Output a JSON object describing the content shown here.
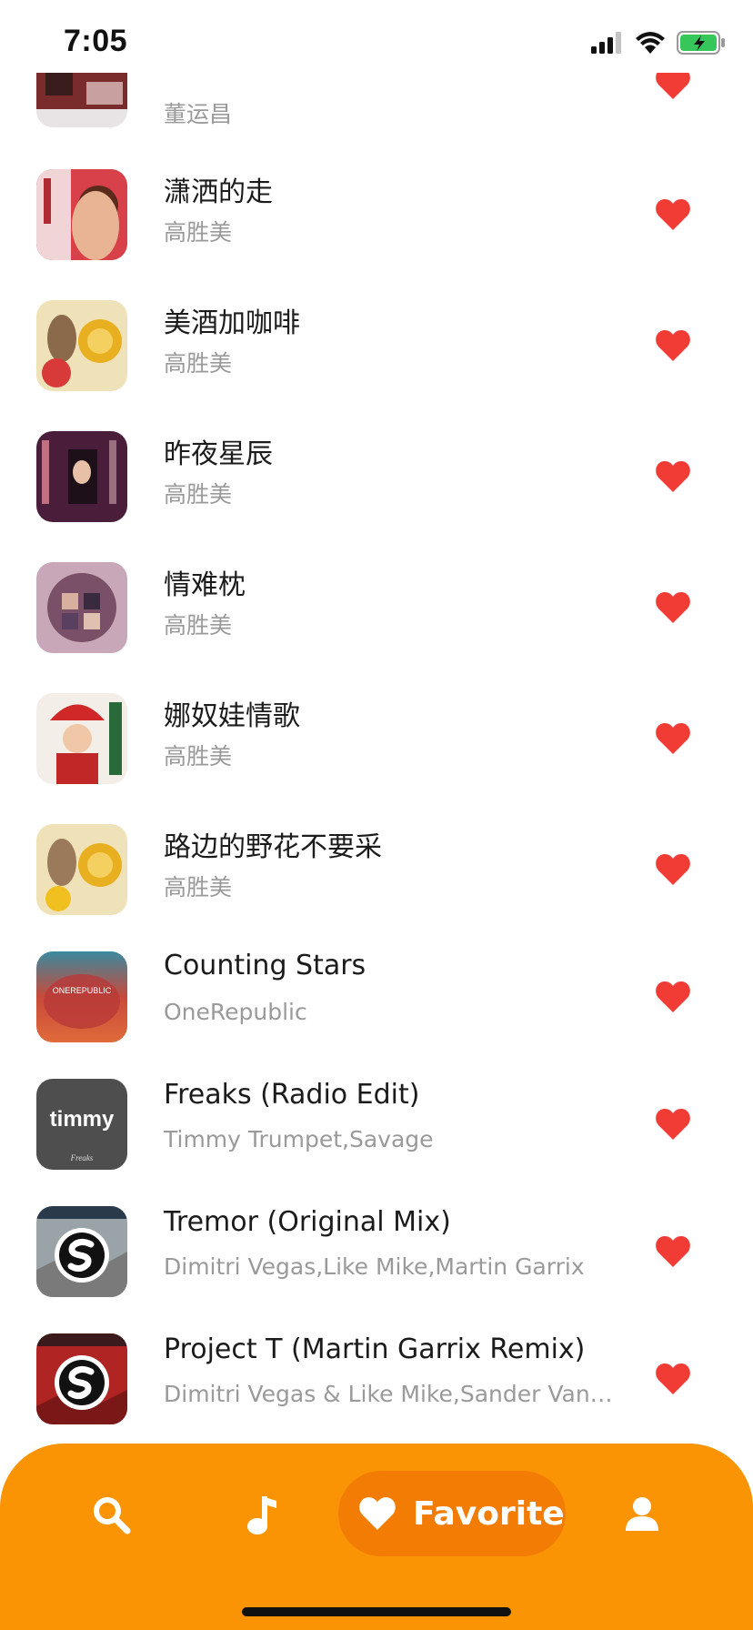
{
  "status_bar": {
    "time": "7:05"
  },
  "songs": [
    {
      "title": "",
      "artist": "董运昌",
      "liked": true
    },
    {
      "title": "潇洒的走",
      "artist": "高胜美",
      "liked": true
    },
    {
      "title": "美酒加咖啡",
      "artist": "高胜美",
      "liked": true
    },
    {
      "title": "昨夜星辰",
      "artist": "高胜美",
      "liked": true
    },
    {
      "title": "情难枕",
      "artist": "高胜美",
      "liked": true
    },
    {
      "title": "娜奴娃情歌",
      "artist": "高胜美",
      "liked": true
    },
    {
      "title": "路边的野花不要采",
      "artist": "高胜美",
      "liked": true
    },
    {
      "title": "Counting Stars",
      "artist": "OneRepublic",
      "liked": true
    },
    {
      "title": "Freaks (Radio Edit)",
      "artist": "Timmy Trumpet,Savage",
      "liked": true
    },
    {
      "title": "Tremor (Original Mix)",
      "artist": "Dimitri Vegas,Like Mike,Martin Garrix",
      "liked": true
    },
    {
      "title": "Project T (Martin Garrix Remix)",
      "artist": "Dimitri Vegas & Like Mike,Sander Van ...",
      "liked": true
    }
  ],
  "covers": {
    "counting_stars_text": "ONEREPUBLIC",
    "freaks_text": "timmy",
    "freaks_subtext": "Freaks"
  },
  "nav": {
    "items": [
      {
        "icon": "search-icon"
      },
      {
        "icon": "music-note-icon"
      },
      {
        "icon": "heart-icon",
        "label": "Favorite",
        "active": true
      },
      {
        "icon": "user-icon"
      }
    ]
  },
  "colors": {
    "accent": "#fb9404",
    "accent_active": "#f27c04",
    "heart": "#f03c35",
    "title": "#1b1b1b",
    "subtitle": "#9a9a9a"
  }
}
